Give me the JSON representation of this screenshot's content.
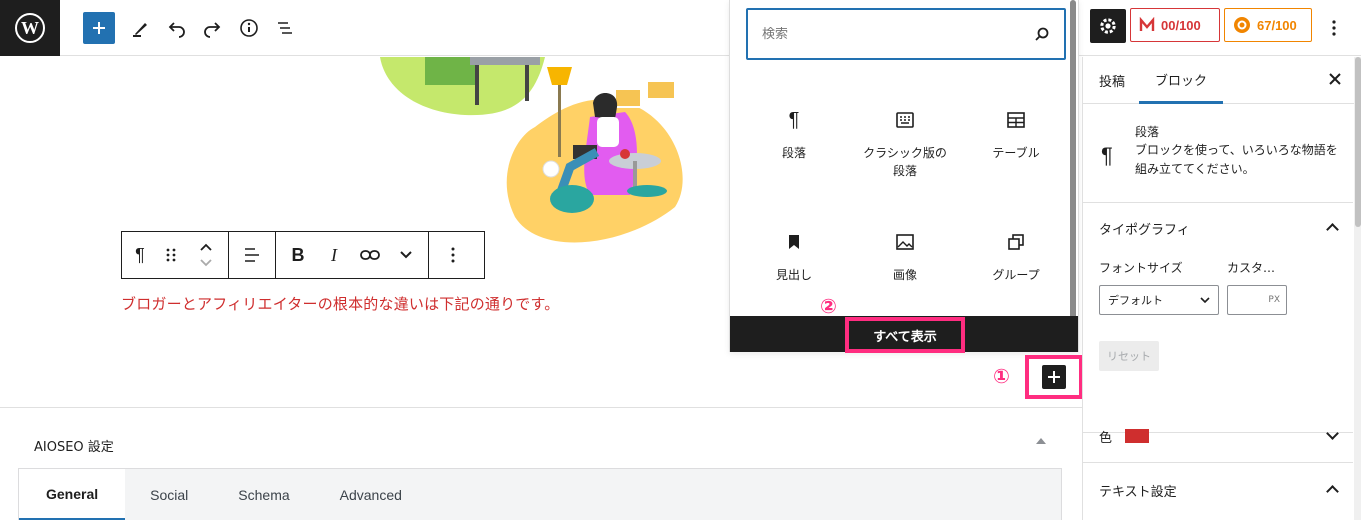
{
  "toolbar": {
    "wp_logo": "wordpress-icon",
    "m_score": "00/100",
    "seo_score": "67/100",
    "colors": {
      "m_score": "#d63638",
      "seo_score": "#f18500",
      "accent": "#2271b1",
      "highlight": "#ff2d80"
    }
  },
  "canvas": {
    "paragraph_text": "ブロガーとアフィリエイターの根本的な違いは下記の通りです。",
    "paragraph_color": "#cf2e2e"
  },
  "inserter": {
    "search_placeholder": "検索",
    "blocks": [
      {
        "label": "段落",
        "icon": "paragraph-icon"
      },
      {
        "label": "クラシック版の段落",
        "icon": "classic-icon"
      },
      {
        "label": "テーブル",
        "icon": "table-icon"
      },
      {
        "label": "見出し",
        "icon": "heading-icon"
      },
      {
        "label": "画像",
        "icon": "image-icon"
      },
      {
        "label": "グループ",
        "icon": "group-icon"
      }
    ],
    "show_all": "すべて表示"
  },
  "annotations": {
    "one": "①",
    "two": "②"
  },
  "aioseo": {
    "title": "AIOSEO 設定",
    "tabs": [
      "General",
      "Social",
      "Schema",
      "Advanced"
    ],
    "active_tab": "General"
  },
  "sidebar": {
    "tabs": [
      "投稿",
      "ブロック"
    ],
    "active_tab": "ブロック",
    "block_name": "段落",
    "block_desc": "ブロックを使って、いろいろな物語を組み立ててください。",
    "typography": "タイポグラフィ",
    "font_size_label": "フォントサイズ",
    "custom_label": "カスタ…",
    "font_size_value": "デフォルト",
    "unit": "PX",
    "reset": "リセット",
    "color": "色",
    "text_settings": "テキスト設定"
  }
}
